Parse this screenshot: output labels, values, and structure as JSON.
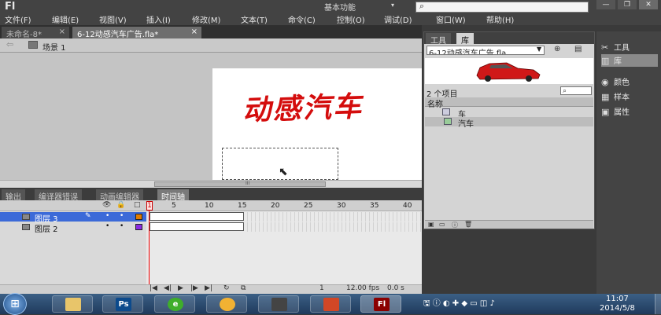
{
  "app": {
    "logo": "Fl",
    "workspace": "基本功能",
    "workspace_arrow": "▾",
    "search_icon": "search-icon"
  },
  "menu": [
    "文件(F)",
    "编辑(E)",
    "视图(V)",
    "插入(I)",
    "修改(M)",
    "文本(T)",
    "命令(C)",
    "控制(O)",
    "调试(D)",
    "窗口(W)",
    "帮助(H)"
  ],
  "window_controls": [
    "—",
    "❐",
    "✕"
  ],
  "doc_tabs": [
    {
      "label": "未命名-8*",
      "close": "×"
    },
    {
      "label": "6-12动感汽车广告.fla*",
      "close": "×"
    }
  ],
  "scene": {
    "back": "⇦",
    "label": "场景 1"
  },
  "stage": {
    "title": "动感汽车",
    "title_color": "#d40d0d"
  },
  "scroll_grip": "III",
  "bottom_tabs": [
    "输出",
    "编译器错误",
    "动画编辑器",
    "时间轴"
  ],
  "timeline": {
    "frame_numbers": [
      "1",
      "5",
      "10",
      "15",
      "20",
      "25",
      "30",
      "35",
      "40"
    ],
    "header_icons": [
      "👁",
      "🔒",
      "□"
    ],
    "layers": [
      {
        "name": "图层 3",
        "color": "#e07b00",
        "selected": true
      },
      {
        "name": "图层 2",
        "color": "#8a2be2",
        "selected": false
      }
    ],
    "current_frame": "1",
    "fps": "12.00 fps",
    "time": "0.0 s"
  },
  "library": {
    "tabs": [
      "工具",
      "库"
    ],
    "doc": "6-12动感汽车广告.fla",
    "count": "2 个项目",
    "column": "名称",
    "items": [
      {
        "name": "车",
        "icon": "movieclip-icon"
      },
      {
        "name": "汽车",
        "icon": "graphic-icon"
      }
    ]
  },
  "dock": [
    {
      "label": "工具",
      "icon": "✂"
    },
    {
      "label": "库",
      "icon": "▥"
    },
    {
      "label": "颜色",
      "icon": "◉"
    },
    {
      "label": "样本",
      "icon": "▦"
    },
    {
      "label": "属性",
      "icon": "▣"
    }
  ],
  "taskbar": {
    "apps": [
      "explorer",
      "Ps",
      "e",
      "qq",
      "camera",
      "ppt",
      "Fl"
    ],
    "clock_time": "11:07",
    "clock_date": "2014/5/8"
  }
}
